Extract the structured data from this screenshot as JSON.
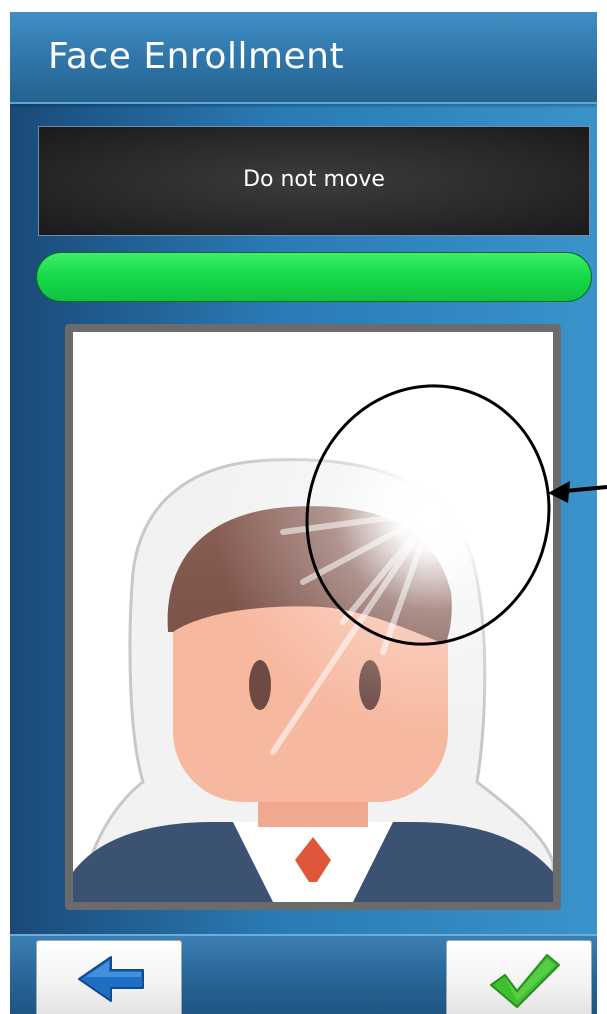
{
  "header": {
    "title": "Face Enrollment"
  },
  "status": {
    "message": "Do not move"
  },
  "progress": {
    "fraction": 1.0
  },
  "photo": {
    "subject": "enrollment face guide with avatar silhouette and light glare"
  },
  "footer": {
    "back_icon": "back-arrow-icon",
    "confirm_icon": "checkmark-icon"
  },
  "colors": {
    "progress_fill": "#16d84a",
    "accent_blue": "#2a7ab4",
    "confirm_green": "#3fbf2f",
    "back_blue": "#1e6fc4"
  }
}
